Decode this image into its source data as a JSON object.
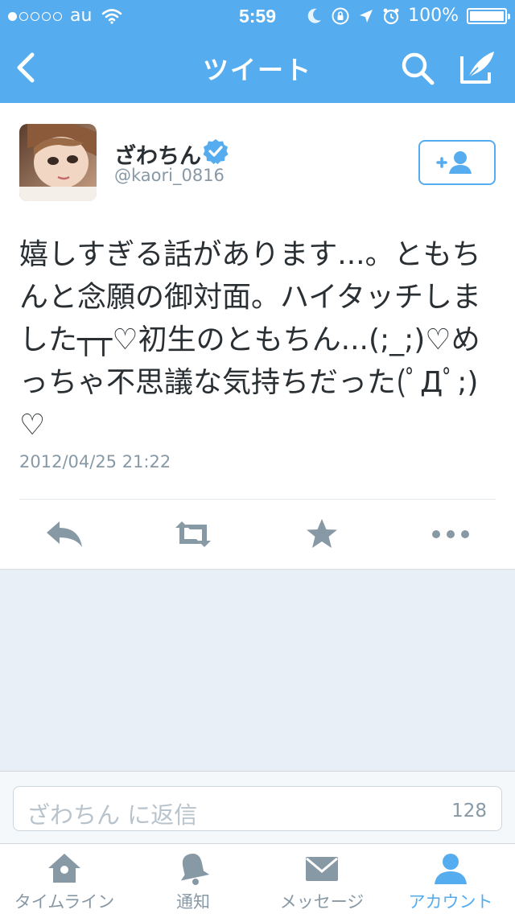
{
  "status_bar": {
    "carrier": "au",
    "time": "5:59",
    "battery_percent": "100%",
    "battery_level": 1.0,
    "signal_bars": 1,
    "signal_total": 5
  },
  "nav": {
    "title": "ツイート",
    "icons": [
      "back-chevron-icon",
      "search-icon",
      "compose-icon"
    ]
  },
  "tweet": {
    "author_name": "ざわちん",
    "handle": "@kaori_0816",
    "verified": true,
    "text": "嬉しすぎる話があります...。ともちんと念願の御対面。ハイタッチしました┬┬♡初生のともちん...(;_;)♡めっちゃ不思議な気持ちだった(ﾟДﾟ;)♡",
    "timestamp": "2012/04/25 21:22",
    "actions": [
      "reply-icon",
      "retweet-icon",
      "favorite-icon",
      "more-icon"
    ]
  },
  "reply": {
    "placeholder": "ざわちん に返信",
    "char_count": "128"
  },
  "tabs": [
    {
      "label": "タイムライン",
      "icon": "home-icon",
      "active": false
    },
    {
      "label": "通知",
      "icon": "bell-icon",
      "active": false
    },
    {
      "label": "メッセージ",
      "icon": "envelope-icon",
      "active": false
    },
    {
      "label": "アカウント",
      "icon": "person-icon",
      "active": true
    }
  ],
  "colors": {
    "accent": "#55acee",
    "muted": "#8899a6",
    "text": "#292f33",
    "background": "#e9eff6"
  }
}
